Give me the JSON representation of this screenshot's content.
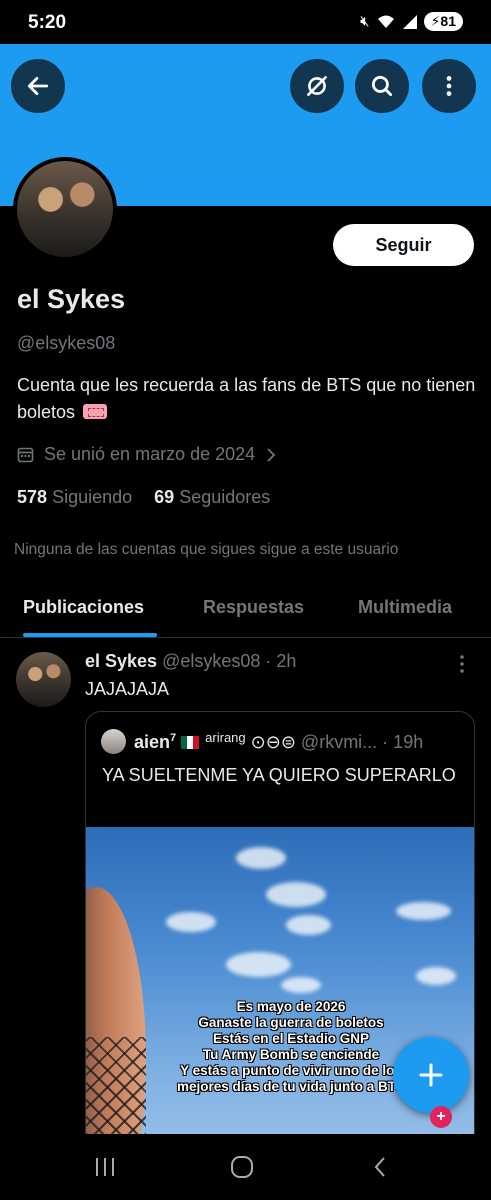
{
  "status_bar": {
    "time": "5:20",
    "battery": "81"
  },
  "profile": {
    "display_name": "el Sykes",
    "handle": "@elsykes08",
    "bio": "Cuenta que les recuerda a las fans de BTS que no tienen boletos",
    "joined": "Se unió en marzo de 2024",
    "following_count": "578",
    "following_label": "Siguiendo",
    "followers_count": "69",
    "followers_label": "Seguidores",
    "mutual_note": "Ninguna de las cuentas que sigues sigue a este usuario",
    "follow_label": "Seguir"
  },
  "header_icons": [
    "back-arrow-icon",
    "no-sync-icon",
    "search-icon",
    "more-vertical-icon"
  ],
  "tabs": [
    {
      "label": "Publicaciones",
      "active": true
    },
    {
      "label": "Respuestas",
      "active": false
    },
    {
      "label": "Multimedia",
      "active": false
    }
  ],
  "post": {
    "name": "el Sykes",
    "handle_time": "@elsykes08 · 2h",
    "text": "JAJAJAJA",
    "quote": {
      "name": "aien",
      "name_sup": "7",
      "badge": "arirang",
      "symbols": "⊙⊖⊜",
      "handle_time": "@rkvmi... · 19h",
      "text": "YA SUELTENME YA QUIERO SUPERARLO",
      "overlay_lines": [
        "Es mayo de 2026",
        "Ganaste la guerra de boletos",
        "Estás en el Estadio GNP",
        "Tu Army Bomb se enciende",
        "Y estás a punto de vivir uno de los",
        "mejores días de tu vida junto a BTS"
      ]
    }
  },
  "colors": {
    "accent": "#1d9bf0",
    "background": "#000000",
    "muted": "#71767b"
  }
}
